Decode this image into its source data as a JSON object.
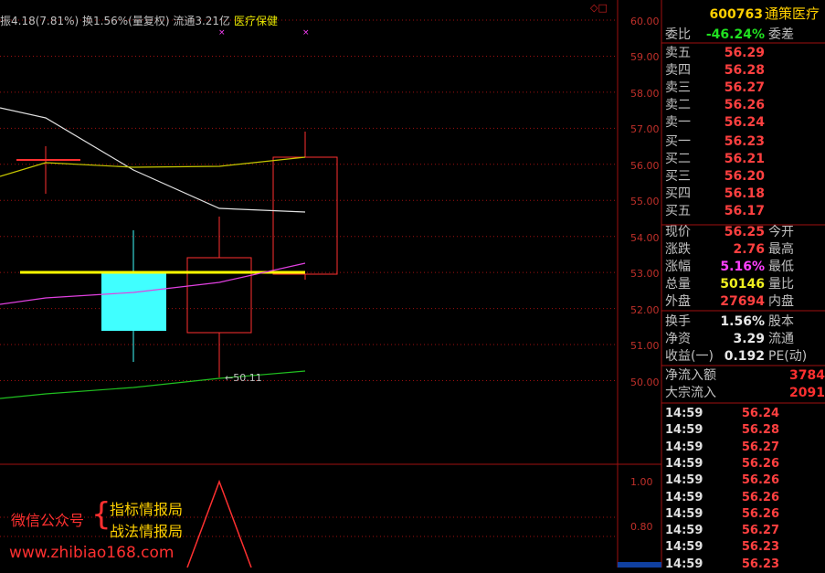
{
  "info_bar": {
    "text": "振4.18(7.81%) 换1.56%(量复权) 流通3.21亿",
    "sector": "医疗保健"
  },
  "corner_icons": "◇□",
  "y_axis": [
    "60.00",
    "59.00",
    "58.00",
    "57.00",
    "56.00",
    "55.00",
    "54.00",
    "53.00",
    "52.00",
    "51.00",
    "50.00"
  ],
  "sub_axis": [
    "1.00",
    "0.80"
  ],
  "low_marker": "←50.11",
  "stock": {
    "code": "600763",
    "name": "通策医疗"
  },
  "weibi": {
    "label": "委比",
    "value": "-46.24%",
    "label2": "委差"
  },
  "asks": [
    {
      "label": "卖五",
      "price": "56.29"
    },
    {
      "label": "卖四",
      "price": "56.28"
    },
    {
      "label": "卖三",
      "price": "56.27"
    },
    {
      "label": "卖二",
      "price": "56.26"
    },
    {
      "label": "卖一",
      "price": "56.24"
    }
  ],
  "bids": [
    {
      "label": "买一",
      "price": "56.23"
    },
    {
      "label": "买二",
      "price": "56.21"
    },
    {
      "label": "买三",
      "price": "56.20"
    },
    {
      "label": "买四",
      "price": "56.18"
    },
    {
      "label": "买五",
      "price": "56.17"
    }
  ],
  "quote": [
    {
      "label": "现价",
      "value": "56.25",
      "label2": "今开"
    },
    {
      "label": "涨跌",
      "value": "2.76",
      "label2": "最高"
    },
    {
      "label": "涨幅",
      "value": "5.16%",
      "label2": "最低"
    },
    {
      "label": "总量",
      "value": "50146",
      "label2": "量比"
    },
    {
      "label": "外盘",
      "value": "27694",
      "label2": "内盘"
    }
  ],
  "fundamentals": [
    {
      "label": "换手",
      "value": "1.56%",
      "label2": "股本"
    },
    {
      "label": "净资",
      "value": "3.29",
      "label2": "流通"
    },
    {
      "label": "收益(一)",
      "value": "0.192",
      "label2": "PE(动)"
    }
  ],
  "flows": [
    {
      "label": "净流入额",
      "value": "3784"
    },
    {
      "label": "大宗流入",
      "value": "2091"
    }
  ],
  "ticks": [
    {
      "time": "14:59",
      "price": "56.24"
    },
    {
      "time": "14:59",
      "price": "56.28"
    },
    {
      "time": "14:59",
      "price": "56.27"
    },
    {
      "time": "14:59",
      "price": "56.26"
    },
    {
      "time": "14:59",
      "price": "56.26"
    },
    {
      "time": "14:59",
      "price": "56.26"
    },
    {
      "time": "14:59",
      "price": "56.26"
    },
    {
      "time": "14:59",
      "price": "56.27"
    },
    {
      "time": "14:59",
      "price": "56.23"
    },
    {
      "time": "14:59",
      "price": "56.23"
    }
  ],
  "watermark": {
    "pub": "微信公众号",
    "line1": "指标情报局",
    "line2": "战法情报局",
    "url": "www.zhibiao168.com"
  },
  "colors": {
    "up": "#ff3030",
    "down": "#40ffff",
    "grid": "#a01010",
    "ma5": "#e0e0e0",
    "ma10": "#c8c800",
    "ma20": "#e040e0",
    "ma60": "#20c020"
  }
}
